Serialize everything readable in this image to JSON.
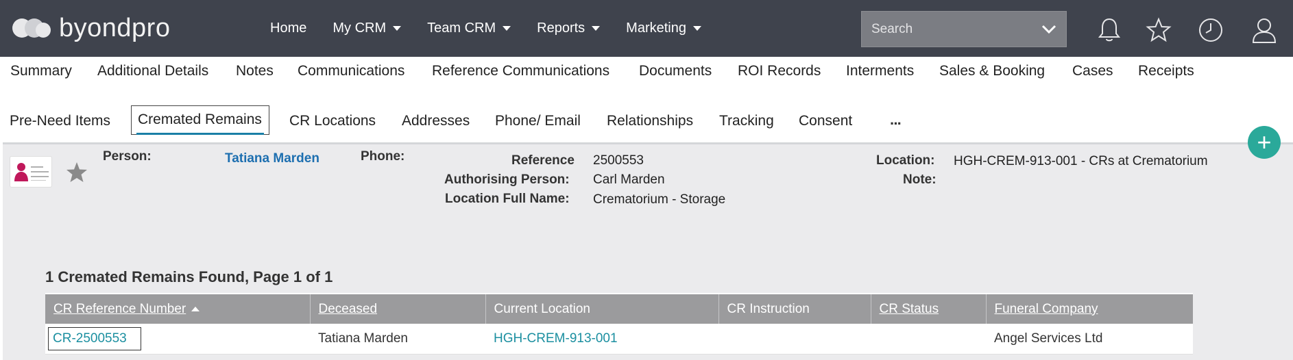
{
  "app": {
    "logo_text": "byondpro"
  },
  "nav": {
    "items": [
      {
        "label": "Home",
        "dropdown": false
      },
      {
        "label": "My CRM",
        "dropdown": true
      },
      {
        "label": "Team CRM",
        "dropdown": true
      },
      {
        "label": "Reports",
        "dropdown": true
      },
      {
        "label": "Marketing",
        "dropdown": true
      }
    ],
    "search_placeholder": "Search"
  },
  "tabs": {
    "row1": [
      "Summary",
      "Additional Details",
      "Notes",
      "Communications",
      "Reference Communications",
      "Documents",
      "ROI Records",
      "Interments",
      "Sales & Booking",
      "Cases",
      "Receipts"
    ],
    "row2": [
      "Pre-Need Items",
      "Cremated Remains",
      "CR Locations",
      "Addresses",
      "Phone/ Email",
      "Relationships",
      "Tracking",
      "Consent"
    ],
    "active": "Cremated Remains",
    "more": "···"
  },
  "record": {
    "person_label": "Person:",
    "person_value": "Tatiana Marden",
    "phone_label": "Phone:",
    "reference_label": "Reference",
    "reference_value": "2500553",
    "authorising_label": "Authorising Person:",
    "authorising_value": "Carl Marden",
    "location_full_label": "Location Full Name:",
    "location_full_value": "Crematorium - Storage",
    "location_label": "Location:",
    "location_value": "HGH-CREM-913-001 - CRs at Crematorium",
    "note_label": "Note:"
  },
  "results": {
    "summary": "1 Cremated Remains Found, Page 1 of 1",
    "columns": [
      "CR Reference Number",
      "Deceased",
      "Current Location",
      "CR Instruction",
      "CR Status",
      "Funeral Company"
    ],
    "rows": [
      {
        "ref": "CR-2500553",
        "deceased": "Tatiana Marden",
        "location": "HGH-CREM-913-001",
        "instruction": "",
        "status": "",
        "company": "Angel Services Ltd"
      }
    ]
  },
  "colors": {
    "topbar": "#3f434d",
    "accent": "#1a7fa6",
    "fab": "#2aa99a",
    "link": "#1d6fb0"
  },
  "icons": {
    "search_toggle": "chevron-down-icon",
    "bell": "bell-icon",
    "star": "star-icon",
    "clock": "clock-icon",
    "user": "user-icon",
    "add": "plus-icon"
  }
}
